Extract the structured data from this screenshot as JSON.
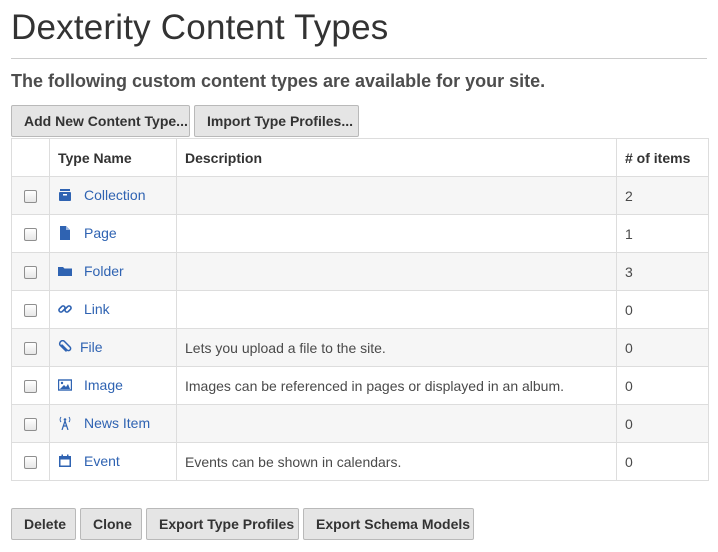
{
  "page": {
    "title": "Dexterity Content Types",
    "lead": "The following custom content types are available for your site."
  },
  "toolbar": {
    "add_label": "Add New Content Type...",
    "import_label": "Import Type Profiles..."
  },
  "table": {
    "headers": {
      "name": "Type Name",
      "description": "Description",
      "count": "# of items"
    },
    "rows": [
      {
        "name": "Collection",
        "icon": "collection-icon",
        "description": "",
        "count": "2"
      },
      {
        "name": "Page",
        "icon": "page-icon",
        "description": "",
        "count": "1"
      },
      {
        "name": "Folder",
        "icon": "folder-icon",
        "description": "",
        "count": "3"
      },
      {
        "name": "Link",
        "icon": "link-icon",
        "description": "",
        "count": "0"
      },
      {
        "name": "File",
        "icon": "paperclip-icon",
        "description": "Lets you upload a file to the site.",
        "count": "0"
      },
      {
        "name": "Image",
        "icon": "image-icon",
        "description": "Images can be referenced in pages or displayed in an album.",
        "count": "0"
      },
      {
        "name": "News Item",
        "icon": "broadcast-icon",
        "description": "",
        "count": "0"
      },
      {
        "name": "Event",
        "icon": "calendar-icon",
        "description": "Events can be shown in calendars.",
        "count": "0"
      }
    ]
  },
  "actions": {
    "delete_label": "Delete",
    "clone_label": "Clone",
    "export_profiles_label": "Export Type Profiles",
    "export_models_label": "Export Schema Models"
  },
  "colors": {
    "link": "#2f63b2",
    "button_bg": "#e5e5e5",
    "row_alt": "#f6f6f6"
  }
}
